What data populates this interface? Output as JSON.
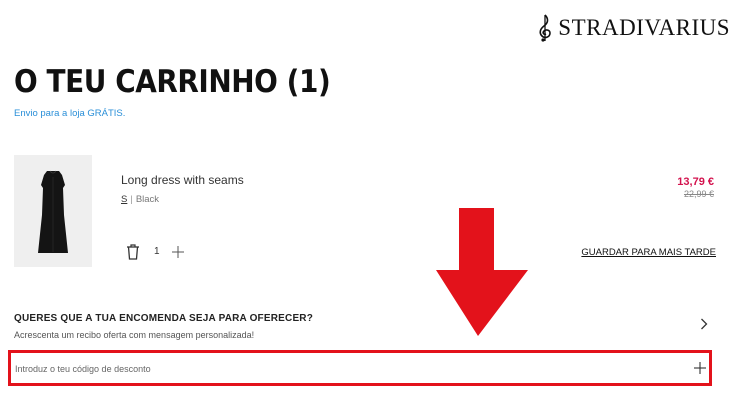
{
  "header": {
    "logo_text": "STRADIVARIUS",
    "logo_icon": "treble-clef-icon"
  },
  "cart": {
    "title": "O TEU CARRINHO (1)",
    "shipping_note": "Envio para a loja GRÁTIS."
  },
  "item": {
    "name": "Long dress with seams",
    "size": "S",
    "color": "Black",
    "price_current": "13,79 €",
    "price_original": "22,99 €",
    "quantity": "1",
    "save_for_later": "GUARDAR PARA MAIS TARDE",
    "icons": [
      "trash-icon",
      "plus-icon"
    ]
  },
  "gift": {
    "title": "QUERES QUE A TUA ENCOMENDA SEJA PARA OFERECER?",
    "description": "Acrescenta um recibo oferta com mensagem personalizada!",
    "icon": "chevron-right-icon"
  },
  "discount": {
    "placeholder": "Introduz o teu código de desconto",
    "value": "",
    "icon": "plus-icon"
  },
  "annotation": {
    "arrow_color": "#e3121b",
    "highlight_color": "#e3121b"
  },
  "colors": {
    "price_accent": "#d3124d",
    "link_blue": "#2a8fd8"
  }
}
